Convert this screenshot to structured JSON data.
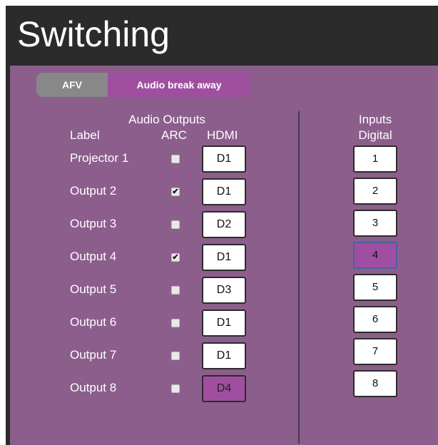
{
  "page": {
    "title": "Switching"
  },
  "tabs": [
    {
      "label": "AFV",
      "active": false
    },
    {
      "label": "Audio break away",
      "active": true
    }
  ],
  "audio_outputs": {
    "heading": "Audio Outputs",
    "col_label": "Label",
    "col_arc": "ARC",
    "col_hdmi": "HDMI",
    "rows": [
      {
        "label": "Projector 1",
        "arc": "",
        "hdmi": "D1"
      },
      {
        "label": "Output 2",
        "arc": "✔",
        "hdmi": "D1"
      },
      {
        "label": "Output 3",
        "arc": "",
        "hdmi": "D2"
      },
      {
        "label": "Output 4",
        "arc": "✔",
        "hdmi": "D1"
      },
      {
        "label": "Output 5",
        "arc": "",
        "hdmi": "D3"
      },
      {
        "label": "Output 6",
        "arc": "",
        "hdmi": "D1"
      },
      {
        "label": "Output 7",
        "arc": "",
        "hdmi": "D1"
      },
      {
        "label": "Output 8",
        "arc": "",
        "hdmi": "D4"
      }
    ],
    "selected_row": 7
  },
  "inputs": {
    "heading": "Inputs",
    "subheading": "Digital",
    "buttons": [
      "1",
      "2",
      "3",
      "4",
      "5",
      "6",
      "7",
      "8"
    ],
    "selected": "4"
  },
  "colors": {
    "header_bg": "#2b2b2b",
    "panel_bg": "#8c5e8c",
    "accent": "#a04fa0",
    "tab_inactive": "#888888"
  }
}
